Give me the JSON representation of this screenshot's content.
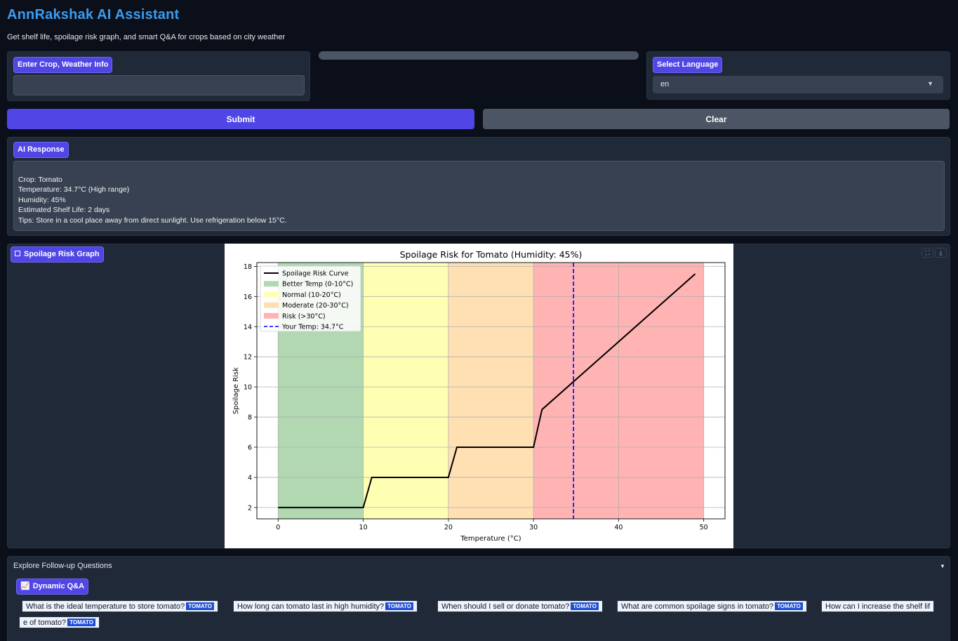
{
  "app": {
    "title": "AnnRakshak AI Assistant",
    "subtitle": "Get shelf life, spoilage risk graph, and smart Q&A for crops based on city weather"
  },
  "input": {
    "label": "Enter Crop, Weather Info",
    "value": ""
  },
  "language": {
    "label": "Select Language",
    "selected": "en"
  },
  "actions": {
    "submit_label": "Submit",
    "clear_label": "Clear"
  },
  "response": {
    "label": "AI Response",
    "lines": [
      "Crop: Tomato",
      "Temperature: 34.7°C (High range)",
      "Humidity: 45%",
      "Estimated Shelf Life: 2 days",
      "Tips: Store in a cool place away from direct sunlight. Use refrigeration below 15°C."
    ]
  },
  "graph": {
    "label": "Spoilage Risk Graph",
    "icon": "image-icon",
    "fullscreen_icon": "fullscreen-icon",
    "download_icon": "download-icon"
  },
  "chart_data": {
    "type": "line",
    "title": "Spoilage Risk for Tomato (Humidity: 45%)",
    "xlabel": "Temperature (°C)",
    "ylabel": "Spoilage Risk",
    "xlim": [
      -2.5,
      52.5
    ],
    "ylim": [
      1.25,
      18.25
    ],
    "xticks": [
      0,
      10,
      20,
      30,
      40,
      50
    ],
    "yticks": [
      2,
      4,
      6,
      8,
      10,
      12,
      14,
      16,
      18
    ],
    "grid": true,
    "legend_position": "top-left",
    "bands": [
      {
        "name": "Better Temp (0-10°C)",
        "from": 0,
        "to": 10,
        "color": "#b2d8b2"
      },
      {
        "name": "Normal (10-20°C)",
        "from": 10,
        "to": 20,
        "color": "#ffffb3"
      },
      {
        "name": "Moderate (20-30°C)",
        "from": 20,
        "to": 30,
        "color": "#ffe0b3"
      },
      {
        "name": "Risk (>30°C)",
        "from": 30,
        "to": 50,
        "color": "#ffb3b3"
      }
    ],
    "series": [
      {
        "name": "Spoilage Risk Curve",
        "color": "#000000",
        "x": [
          0,
          10,
          11,
          20,
          21,
          30,
          31,
          49
        ],
        "y": [
          2,
          2,
          4,
          4,
          6,
          6,
          8.5,
          17.5
        ]
      }
    ],
    "vline": {
      "name": "Your Temp: 34.7°C",
      "x": 34.7,
      "color": "#0000ff"
    }
  },
  "followup": {
    "title": "Explore Follow-up Questions",
    "label": "Dynamic Q&A",
    "icon": "chart-icon",
    "questions": [
      {
        "text": "What is the ideal temperature to store tomato?",
        "tag": "TOMATO"
      },
      {
        "text": "How long can tomato last in high humidity?",
        "tag": "TOMATO"
      },
      {
        "text": "When should I sell or donate tomato?",
        "tag": "TOMATO"
      },
      {
        "text": "What are common spoilage signs in tomato?",
        "tag": "TOMATO"
      },
      {
        "text": "How can I increase the shelf lif",
        "tag": ""
      },
      {
        "text": "e of tomato?",
        "tag": "TOMATO"
      }
    ]
  }
}
